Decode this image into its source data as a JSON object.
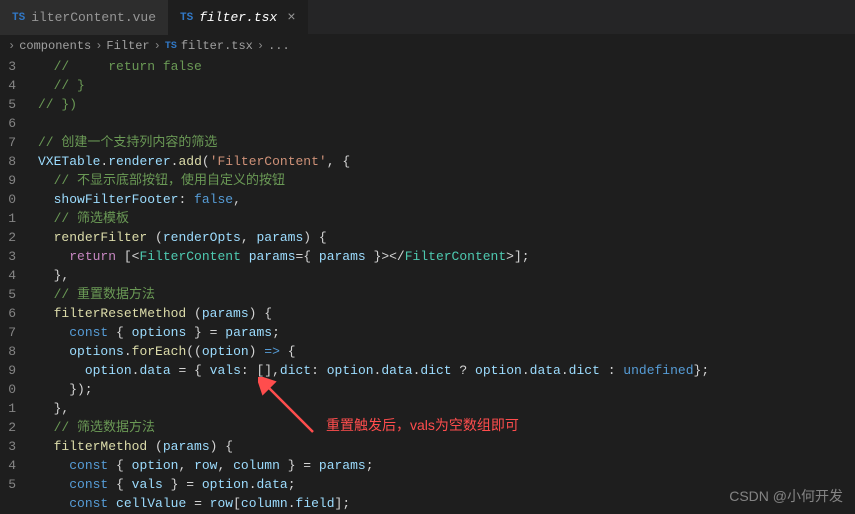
{
  "tabs": [
    {
      "icon": "TS",
      "label": "ilterContent.vue",
      "active": false
    },
    {
      "icon": "TS",
      "label": "filter.tsx",
      "active": true
    }
  ],
  "breadcrumb": {
    "parts": [
      "components",
      "Filter",
      "filter.tsx",
      "..."
    ],
    "icon": "TS"
  },
  "gutter": [
    "3",
    "4",
    "5",
    "6",
    "7",
    "8",
    "9",
    "0",
    "1",
    "2",
    "3",
    "4",
    "5",
    "6",
    "7",
    "8",
    "9",
    "0",
    "1",
    "2",
    "3",
    "4",
    "5"
  ],
  "code_tokens": [
    [
      {
        "t": "  // ",
        "c": "c-comment"
      },
      {
        "t": "    return false",
        "c": "c-comment"
      }
    ],
    [
      {
        "t": "  // }",
        "c": "c-comment"
      }
    ],
    [
      {
        "t": "// })",
        "c": "c-comment"
      }
    ],
    [],
    [
      {
        "t": "// 创建一个支持列内容的筛选",
        "c": "c-comment"
      }
    ],
    [
      {
        "t": "VXETable",
        "c": "c-ident"
      },
      {
        "t": ".",
        "c": "c-punct"
      },
      {
        "t": "renderer",
        "c": "c-ident"
      },
      {
        "t": ".",
        "c": "c-punct"
      },
      {
        "t": "add",
        "c": "c-func"
      },
      {
        "t": "(",
        "c": "c-punct"
      },
      {
        "t": "'FilterContent'",
        "c": "c-string"
      },
      {
        "t": ", {",
        "c": "c-punct"
      }
    ],
    [
      {
        "t": "  ",
        "c": ""
      },
      {
        "t": "// 不显示底部按钮，使用自定义的按钮",
        "c": "c-comment"
      }
    ],
    [
      {
        "t": "  ",
        "c": ""
      },
      {
        "t": "showFilterFooter",
        "c": "c-ident"
      },
      {
        "t": ": ",
        "c": "c-punct"
      },
      {
        "t": "false",
        "c": "c-const"
      },
      {
        "t": ",",
        "c": "c-punct"
      }
    ],
    [
      {
        "t": "  ",
        "c": ""
      },
      {
        "t": "// 筛选模板",
        "c": "c-comment"
      }
    ],
    [
      {
        "t": "  ",
        "c": ""
      },
      {
        "t": "renderFilter",
        "c": "c-func"
      },
      {
        "t": " (",
        "c": "c-punct"
      },
      {
        "t": "renderOpts",
        "c": "c-ident"
      },
      {
        "t": ", ",
        "c": "c-punct"
      },
      {
        "t": "params",
        "c": "c-ident"
      },
      {
        "t": ") {",
        "c": "c-punct"
      }
    ],
    [
      {
        "t": "    ",
        "c": ""
      },
      {
        "t": "return",
        "c": "c-return"
      },
      {
        "t": " [",
        "c": "c-punct"
      },
      {
        "t": "<",
        "c": "c-punct"
      },
      {
        "t": "FilterContent",
        "c": "c-type"
      },
      {
        "t": " ",
        "c": ""
      },
      {
        "t": "params",
        "c": "c-ident"
      },
      {
        "t": "={ ",
        "c": "c-punct"
      },
      {
        "t": "params",
        "c": "c-ident"
      },
      {
        "t": " }",
        "c": "c-punct"
      },
      {
        "t": "></",
        "c": "c-punct"
      },
      {
        "t": "FilterContent",
        "c": "c-type"
      },
      {
        "t": ">];",
        "c": "c-punct"
      }
    ],
    [
      {
        "t": "  },",
        "c": "c-punct"
      }
    ],
    [
      {
        "t": "  ",
        "c": ""
      },
      {
        "t": "// 重置数据方法",
        "c": "c-comment"
      }
    ],
    [
      {
        "t": "  ",
        "c": ""
      },
      {
        "t": "filterResetMethod",
        "c": "c-func"
      },
      {
        "t": " (",
        "c": "c-punct"
      },
      {
        "t": "params",
        "c": "c-ident"
      },
      {
        "t": ") {",
        "c": "c-punct"
      }
    ],
    [
      {
        "t": "    ",
        "c": ""
      },
      {
        "t": "const",
        "c": "c-keyword"
      },
      {
        "t": " { ",
        "c": "c-punct"
      },
      {
        "t": "options",
        "c": "c-ident"
      },
      {
        "t": " } = ",
        "c": "c-punct"
      },
      {
        "t": "params",
        "c": "c-ident"
      },
      {
        "t": ";",
        "c": "c-punct"
      }
    ],
    [
      {
        "t": "    ",
        "c": ""
      },
      {
        "t": "options",
        "c": "c-ident"
      },
      {
        "t": ".",
        "c": "c-punct"
      },
      {
        "t": "forEach",
        "c": "c-func"
      },
      {
        "t": "((",
        "c": "c-punct"
      },
      {
        "t": "option",
        "c": "c-ident"
      },
      {
        "t": ") ",
        "c": "c-punct"
      },
      {
        "t": "=>",
        "c": "c-keyword"
      },
      {
        "t": " {",
        "c": "c-punct"
      }
    ],
    [
      {
        "t": "      ",
        "c": ""
      },
      {
        "t": "option",
        "c": "c-ident"
      },
      {
        "t": ".",
        "c": "c-punct"
      },
      {
        "t": "data",
        "c": "c-ident"
      },
      {
        "t": " = { ",
        "c": "c-punct"
      },
      {
        "t": "vals",
        "c": "c-ident"
      },
      {
        "t": ": [],",
        "c": "c-punct"
      },
      {
        "t": "dict",
        "c": "c-ident"
      },
      {
        "t": ": ",
        "c": "c-punct"
      },
      {
        "t": "option",
        "c": "c-ident"
      },
      {
        "t": ".",
        "c": "c-punct"
      },
      {
        "t": "data",
        "c": "c-ident"
      },
      {
        "t": ".",
        "c": "c-punct"
      },
      {
        "t": "dict",
        "c": "c-ident"
      },
      {
        "t": " ? ",
        "c": "c-punct"
      },
      {
        "t": "option",
        "c": "c-ident"
      },
      {
        "t": ".",
        "c": "c-punct"
      },
      {
        "t": "data",
        "c": "c-ident"
      },
      {
        "t": ".",
        "c": "c-punct"
      },
      {
        "t": "dict",
        "c": "c-ident"
      },
      {
        "t": " : ",
        "c": "c-punct"
      },
      {
        "t": "undefined",
        "c": "c-const"
      },
      {
        "t": "};",
        "c": "c-punct"
      }
    ],
    [
      {
        "t": "    });",
        "c": "c-punct"
      }
    ],
    [
      {
        "t": "  },",
        "c": "c-punct"
      }
    ],
    [
      {
        "t": "  ",
        "c": ""
      },
      {
        "t": "// 筛选数据方法",
        "c": "c-comment"
      }
    ],
    [
      {
        "t": "  ",
        "c": ""
      },
      {
        "t": "filterMethod",
        "c": "c-func"
      },
      {
        "t": " (",
        "c": "c-punct"
      },
      {
        "t": "params",
        "c": "c-ident"
      },
      {
        "t": ") {",
        "c": "c-punct"
      }
    ],
    [
      {
        "t": "    ",
        "c": ""
      },
      {
        "t": "const",
        "c": "c-keyword"
      },
      {
        "t": " { ",
        "c": "c-punct"
      },
      {
        "t": "option",
        "c": "c-ident"
      },
      {
        "t": ", ",
        "c": "c-punct"
      },
      {
        "t": "row",
        "c": "c-ident"
      },
      {
        "t": ", ",
        "c": "c-punct"
      },
      {
        "t": "column",
        "c": "c-ident"
      },
      {
        "t": " } = ",
        "c": "c-punct"
      },
      {
        "t": "params",
        "c": "c-ident"
      },
      {
        "t": ";",
        "c": "c-punct"
      }
    ],
    [
      {
        "t": "    ",
        "c": ""
      },
      {
        "t": "const",
        "c": "c-keyword"
      },
      {
        "t": " { ",
        "c": "c-punct"
      },
      {
        "t": "vals",
        "c": "c-ident"
      },
      {
        "t": " } = ",
        "c": "c-punct"
      },
      {
        "t": "option",
        "c": "c-ident"
      },
      {
        "t": ".",
        "c": "c-punct"
      },
      {
        "t": "data",
        "c": "c-ident"
      },
      {
        "t": ";",
        "c": "c-punct"
      }
    ],
    [
      {
        "t": "    ",
        "c": ""
      },
      {
        "t": "const",
        "c": "c-keyword"
      },
      {
        "t": " ",
        "c": ""
      },
      {
        "t": "cellValue",
        "c": "c-ident"
      },
      {
        "t": " = ",
        "c": "c-punct"
      },
      {
        "t": "row",
        "c": "c-ident"
      },
      {
        "t": "[",
        "c": "c-punct"
      },
      {
        "t": "column",
        "c": "c-ident"
      },
      {
        "t": ".",
        "c": "c-punct"
      },
      {
        "t": "field",
        "c": "c-ident"
      },
      {
        "t": "];",
        "c": "c-punct"
      }
    ]
  ],
  "annotation": "重置触发后，vals为空数组即可",
  "watermark": "CSDN @小何开发"
}
